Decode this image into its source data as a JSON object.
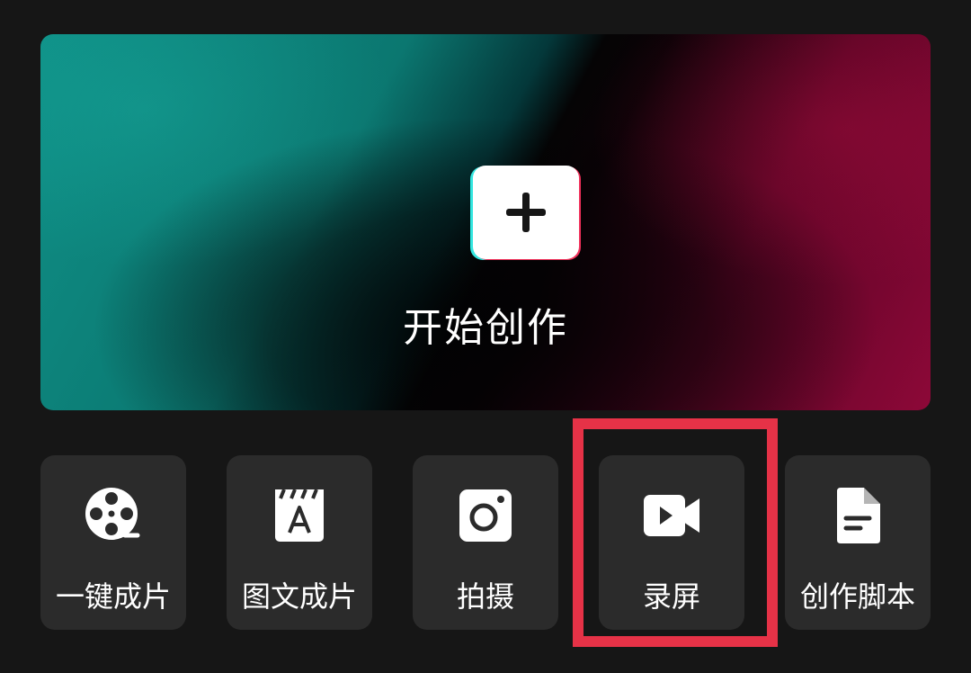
{
  "hero": {
    "label": "开始创作",
    "icon": "plus-icon"
  },
  "tools": [
    {
      "label": "一键成片",
      "icon": "film-reel-icon"
    },
    {
      "label": "图文成片",
      "icon": "text-image-icon"
    },
    {
      "label": "拍摄",
      "icon": "camera-icon"
    },
    {
      "label": "录屏",
      "icon": "video-record-icon"
    },
    {
      "label": "创作脚本",
      "icon": "document-icon"
    }
  ],
  "highlight": {
    "target": "录屏",
    "color": "#e63247"
  }
}
